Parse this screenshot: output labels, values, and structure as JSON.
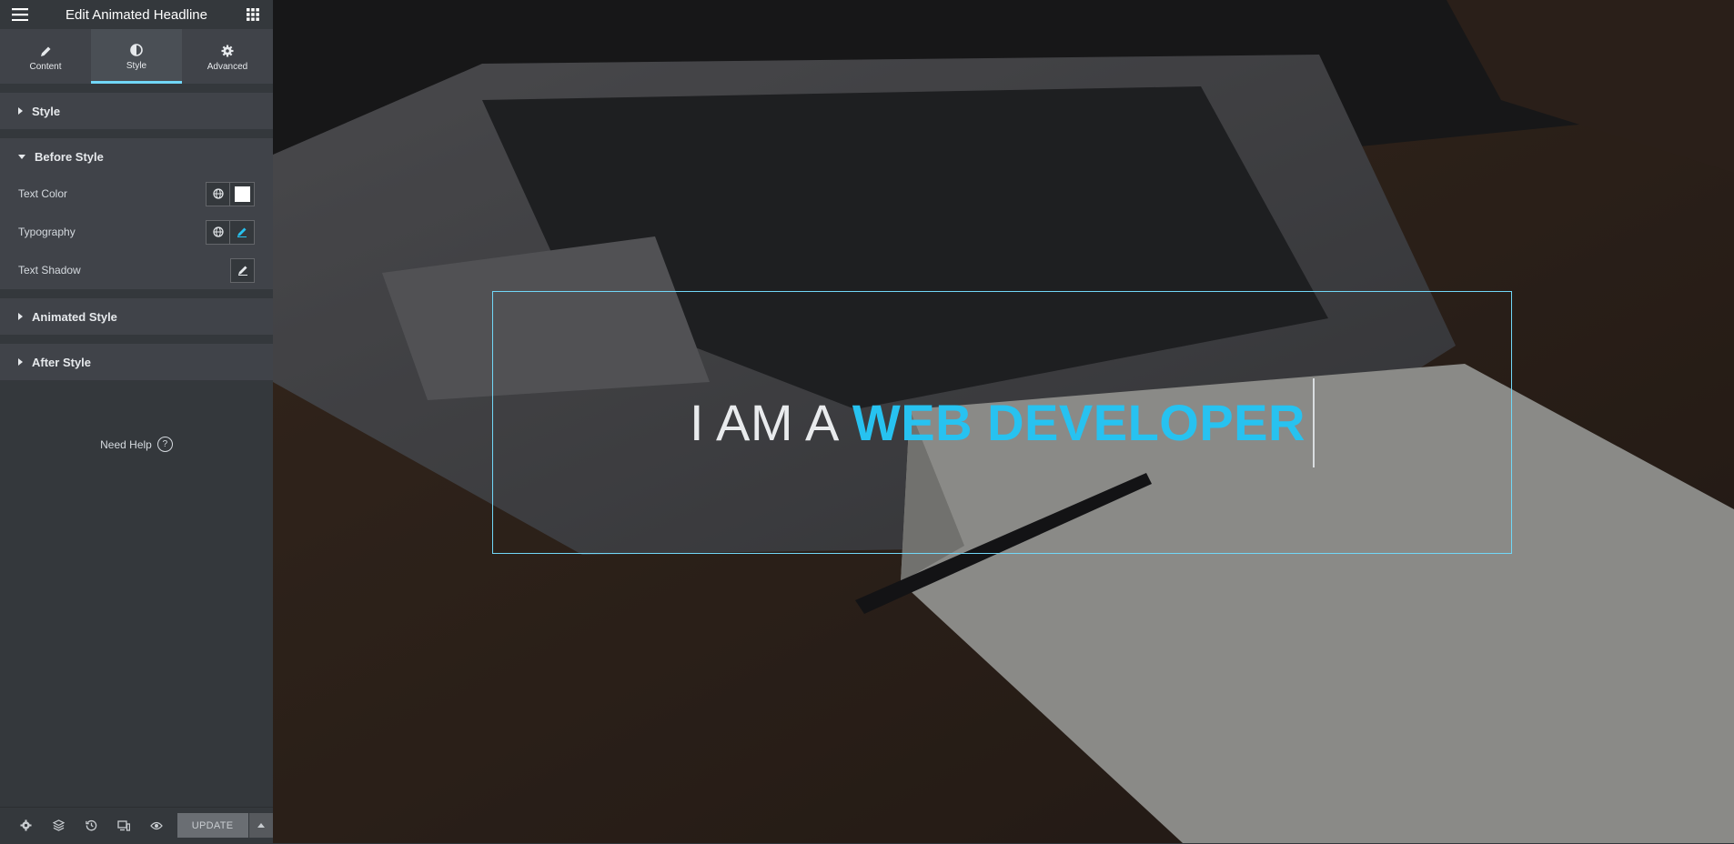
{
  "panel": {
    "title": "Edit Animated Headline",
    "tabs": [
      {
        "label": "Content",
        "icon": "pencil-icon"
      },
      {
        "label": "Style",
        "icon": "contrast-icon",
        "active": true
      },
      {
        "label": "Advanced",
        "icon": "gear-icon"
      }
    ],
    "sections": {
      "style": "Style",
      "before_style": "Before Style",
      "animated_style": "Animated Style",
      "after_style": "After Style"
    },
    "controls": {
      "text_color": "Text Color",
      "typography": "Typography",
      "text_shadow": "Text Shadow"
    },
    "text_color_value": "#ffffff",
    "need_help": "Need Help",
    "help_icon": "?"
  },
  "footer": {
    "update_label": "UPDATE"
  },
  "canvas": {
    "before_text": "I AM A",
    "animated_text": "WEB DEVELOPER",
    "accent": "#27c2f0"
  }
}
